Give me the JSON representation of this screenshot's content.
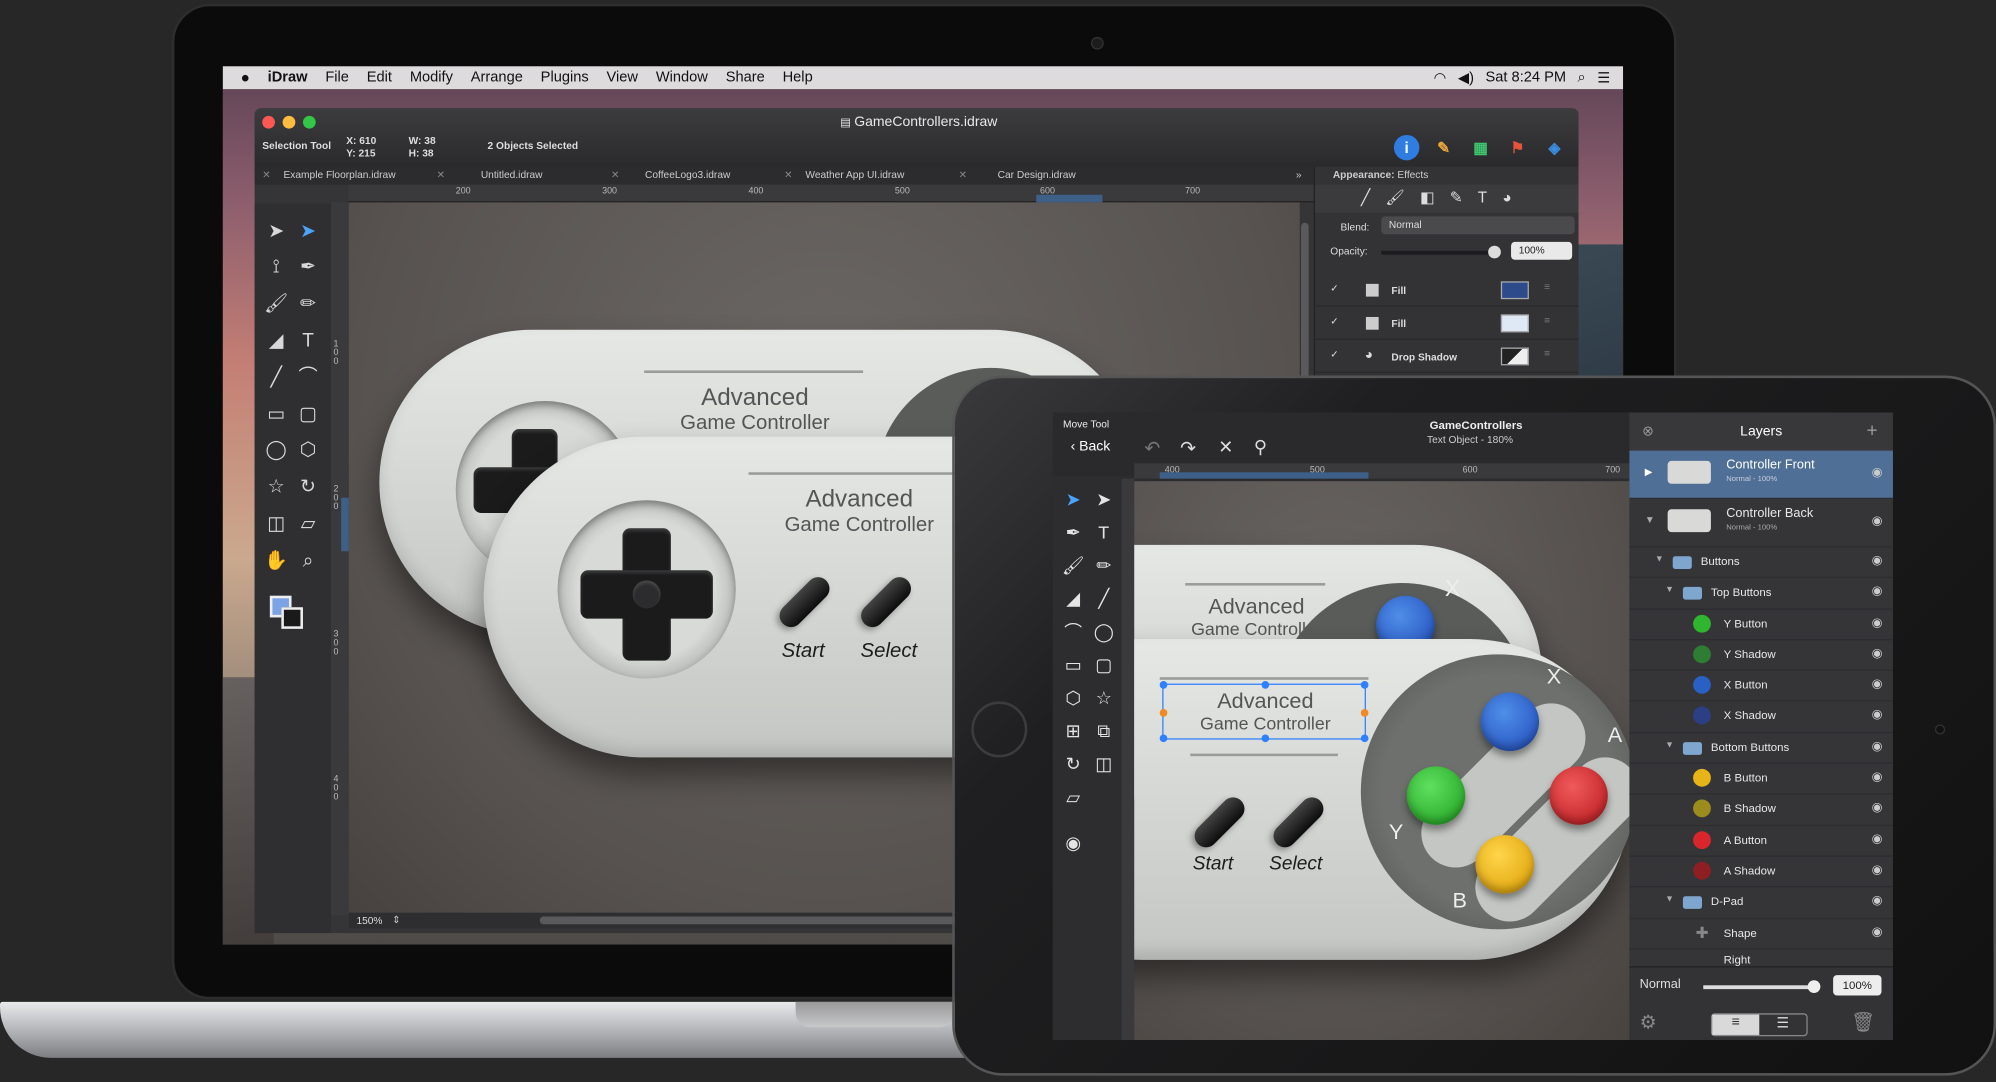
{
  "mac": {
    "menubar": {
      "apple": "",
      "app": "iDraw",
      "items": [
        "File",
        "Edit",
        "Modify",
        "Arrange",
        "Plugins",
        "View",
        "Window",
        "Share",
        "Help"
      ],
      "clock": "Sat 8:24 PM"
    },
    "window": {
      "title": "GameControllers.idraw",
      "tool": "Selection Tool",
      "x": "X: 610",
      "y": "Y: 215",
      "w": "W: 38",
      "h": "H: 38",
      "selection": "2 Objects Selected",
      "tabs": [
        "Example Floorplan.idraw",
        "Untitled.idraw",
        "CoffeeLogo3.idraw",
        "Weather App UI.idraw",
        "Car Design.idraw"
      ],
      "ruler": [
        "200",
        "300",
        "400",
        "500",
        "600",
        "700"
      ],
      "vruler": [
        "1 0 0",
        "2 0 0",
        "3 0 0",
        "4 0 0"
      ],
      "zoom": "150%"
    },
    "appearance": {
      "label": "Appearance:",
      "mode": "Effects",
      "blend_label": "Blend:",
      "blend": "Normal",
      "opacity_label": "Opacity:",
      "opacity": "100%",
      "layers": [
        {
          "name": "Fill",
          "color": "#2d4a8a"
        },
        {
          "name": "Fill",
          "color": "#dfe8f5"
        },
        {
          "name": "Drop Shadow",
          "color": "#222222"
        }
      ]
    },
    "controller": {
      "title1": "Advanced",
      "title2": "Game Controller",
      "start": "Start",
      "select": "Select"
    }
  },
  "ipad": {
    "tool": "Move Tool",
    "back": "Back",
    "doc_title": "GameControllers",
    "doc_sub": "Text Object - 180%",
    "ruler": [
      "400",
      "500",
      "600",
      "700"
    ],
    "controller": {
      "title1": "Advanced",
      "title2": "Game Controller",
      "start": "Start",
      "select": "Select",
      "x": "X",
      "a": "A",
      "y": "Y",
      "b": "B"
    },
    "layers": {
      "title": "Layers",
      "items": [
        {
          "name": "Controller Front",
          "sub": "Normal - 100%"
        },
        {
          "name": "Controller Back",
          "sub": "Normal - 100%"
        },
        {
          "name": "Buttons"
        },
        {
          "name": "Top Buttons"
        },
        {
          "name": "Y Button",
          "color": "#2fb52f"
        },
        {
          "name": "Y Shadow",
          "color": "#2e7d32"
        },
        {
          "name": "X Button",
          "color": "#2a5fc4"
        },
        {
          "name": "X Shadow",
          "color": "#2b3f85"
        },
        {
          "name": "Bottom Buttons"
        },
        {
          "name": "B Button",
          "color": "#e6b417"
        },
        {
          "name": "B Shadow",
          "color": "#9c8b1d"
        },
        {
          "name": "A Button",
          "color": "#d9262b"
        },
        {
          "name": "A Shadow",
          "color": "#8d1e22"
        },
        {
          "name": "D-Pad"
        },
        {
          "name": "Shape"
        },
        {
          "name": "Right"
        }
      ],
      "blend": "Normal",
      "opacity": "100%"
    }
  }
}
